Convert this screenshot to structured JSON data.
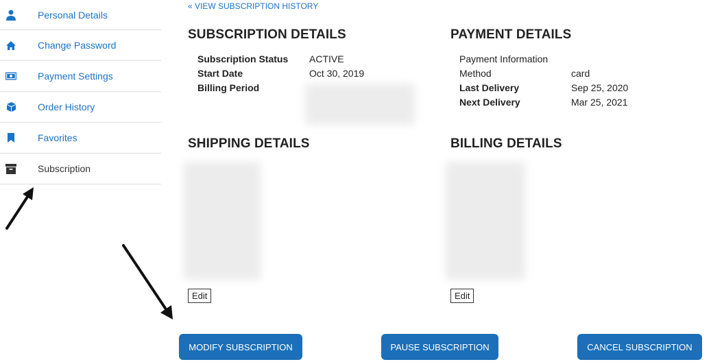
{
  "sidebar": {
    "items": [
      {
        "label": "Personal Details",
        "icon": "person-icon"
      },
      {
        "label": "Change Password",
        "icon": "home-icon"
      },
      {
        "label": "Payment Settings",
        "icon": "money-icon"
      },
      {
        "label": "Order History",
        "icon": "box-icon"
      },
      {
        "label": "Favorites",
        "icon": "bookmark-icon"
      },
      {
        "label": "Subscription",
        "icon": "archive-icon",
        "active": true
      }
    ]
  },
  "history_link": "« VIEW SUBSCRIPTION HISTORY",
  "subscription": {
    "title": "SUBSCRIPTION DETAILS",
    "status_label": "Subscription Status",
    "status_value": "ACTIVE",
    "start_label": "Start Date",
    "start_value": "Oct 30, 2019",
    "billing_period_label": "Billing Period"
  },
  "payment": {
    "title": "PAYMENT DETAILS",
    "info_label": "Payment Information",
    "method_label": "Method",
    "method_value": "card",
    "last_label": "Last Delivery",
    "last_value": "Sep 25, 2020",
    "next_label": "Next Delivery",
    "next_value": "Mar 25, 2021"
  },
  "shipping": {
    "title": "SHIPPING DETAILS",
    "edit_label": "Edit"
  },
  "billing": {
    "title": "BILLING DETAILS",
    "edit_label": "Edit"
  },
  "actions": {
    "modify": "MODIFY SUBSCRIPTION",
    "pause": "PAUSE SUBSCRIPTION",
    "cancel": "CANCEL SUBSCRIPTION"
  },
  "colors": {
    "accent": "#1c6fb8",
    "link": "#1a73c7"
  }
}
